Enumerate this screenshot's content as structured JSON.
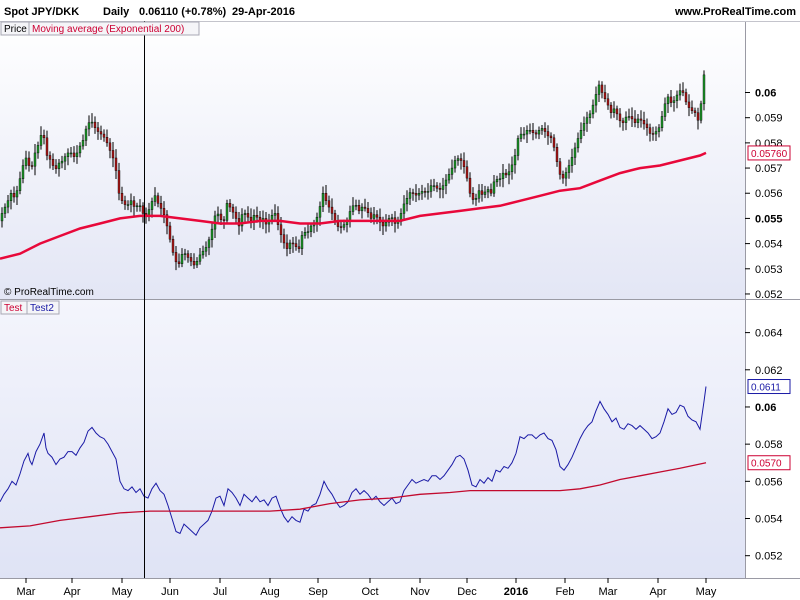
{
  "header": {
    "instrument": "Spot JPY/DKK",
    "period": "Daily",
    "last": "0.06110 (+0.78%)",
    "date": "29-Apr-2016",
    "site": "www.ProRealTime.com"
  },
  "watermark": "© ProRealTime.com",
  "chart_data": [
    {
      "type": "candlestick",
      "legend": [
        "Price",
        "Moving average (Exponential 200)"
      ],
      "yticks": [
        "0.052",
        "0.053",
        "0.054",
        "0.055",
        "0.056",
        "0.057",
        "0.058",
        "0.059",
        "0.06"
      ],
      "ylim": [
        0.0518,
        0.0628
      ],
      "value_labels": [
        {
          "text": "0.05760",
          "value": 0.0576,
          "color": "#cc0033"
        }
      ],
      "price_path": [
        [
          0,
          0.0549
        ],
        [
          4,
          0.0553
        ],
        [
          8,
          0.0556
        ],
        [
          12,
          0.056
        ],
        [
          16,
          0.0558
        ],
        [
          20,
          0.0564
        ],
        [
          24,
          0.0571
        ],
        [
          28,
          0.0575
        ],
        [
          30,
          0.0571
        ],
        [
          32,
          0.0569
        ],
        [
          36,
          0.0576
        ],
        [
          40,
          0.058
        ],
        [
          44,
          0.0586
        ],
        [
          46,
          0.0578
        ],
        [
          48,
          0.0575
        ],
        [
          52,
          0.0573
        ],
        [
          56,
          0.0569
        ],
        [
          60,
          0.0572
        ],
        [
          64,
          0.0573
        ],
        [
          68,
          0.0576
        ],
        [
          72,
          0.0576
        ],
        [
          76,
          0.0574
        ],
        [
          80,
          0.0578
        ],
        [
          84,
          0.0581
        ],
        [
          88,
          0.0587
        ],
        [
          92,
          0.0589
        ],
        [
          96,
          0.0586
        ],
        [
          100,
          0.0584
        ],
        [
          104,
          0.0583
        ],
        [
          108,
          0.058
        ],
        [
          112,
          0.0576
        ],
        [
          116,
          0.0572
        ],
        [
          120,
          0.056
        ],
        [
          124,
          0.0556
        ],
        [
          128,
          0.0555
        ],
        [
          132,
          0.0557
        ],
        [
          136,
          0.0554
        ],
        [
          140,
          0.0556
        ],
        [
          144,
          0.0552
        ],
        [
          148,
          0.0551
        ],
        [
          152,
          0.0556
        ],
        [
          156,
          0.0559
        ],
        [
          160,
          0.0555
        ],
        [
          164,
          0.0553
        ],
        [
          168,
          0.0547
        ],
        [
          172,
          0.054
        ],
        [
          176,
          0.0533
        ],
        [
          180,
          0.0532
        ],
        [
          184,
          0.0537
        ],
        [
          188,
          0.0535
        ],
        [
          192,
          0.0533
        ],
        [
          196,
          0.0531
        ],
        [
          200,
          0.0535
        ],
        [
          204,
          0.0537
        ],
        [
          208,
          0.0539
        ],
        [
          212,
          0.0544
        ],
        [
          216,
          0.0551
        ],
        [
          220,
          0.0552
        ],
        [
          224,
          0.0547
        ],
        [
          228,
          0.0556
        ],
        [
          232,
          0.0554
        ],
        [
          236,
          0.0551
        ],
        [
          240,
          0.0547
        ],
        [
          244,
          0.0553
        ],
        [
          248,
          0.0551
        ],
        [
          252,
          0.0549
        ],
        [
          256,
          0.0552
        ],
        [
          260,
          0.0549
        ],
        [
          264,
          0.055
        ],
        [
          268,
          0.0547
        ],
        [
          272,
          0.0551
        ],
        [
          276,
          0.0552
        ],
        [
          280,
          0.0546
        ],
        [
          284,
          0.0541
        ],
        [
          288,
          0.0538
        ],
        [
          292,
          0.0541
        ],
        [
          296,
          0.0539
        ],
        [
          300,
          0.0538
        ],
        [
          304,
          0.0545
        ],
        [
          308,
          0.0544
        ],
        [
          312,
          0.0547
        ],
        [
          316,
          0.0548
        ],
        [
          320,
          0.0553
        ],
        [
          324,
          0.056
        ],
        [
          328,
          0.0556
        ],
        [
          332,
          0.0553
        ],
        [
          336,
          0.0549
        ],
        [
          340,
          0.0546
        ],
        [
          344,
          0.0547
        ],
        [
          348,
          0.0549
        ],
        [
          352,
          0.0554
        ],
        [
          356,
          0.0556
        ],
        [
          360,
          0.0553
        ],
        [
          364,
          0.0555
        ],
        [
          368,
          0.0553
        ],
        [
          372,
          0.055
        ],
        [
          376,
          0.0552
        ],
        [
          380,
          0.0549
        ],
        [
          384,
          0.0547
        ],
        [
          388,
          0.0549
        ],
        [
          392,
          0.0551
        ],
        [
          396,
          0.0548
        ],
        [
          400,
          0.0549
        ],
        [
          404,
          0.0555
        ],
        [
          408,
          0.0558
        ],
        [
          412,
          0.0561
        ],
        [
          416,
          0.0559
        ],
        [
          420,
          0.056
        ],
        [
          424,
          0.0561
        ],
        [
          428,
          0.056
        ],
        [
          432,
          0.0563
        ],
        [
          436,
          0.0563
        ],
        [
          440,
          0.0561
        ],
        [
          444,
          0.0563
        ],
        [
          448,
          0.0566
        ],
        [
          452,
          0.0569
        ],
        [
          456,
          0.0573
        ],
        [
          460,
          0.0574
        ],
        [
          464,
          0.0572
        ],
        [
          468,
          0.0566
        ],
        [
          472,
          0.0558
        ],
        [
          476,
          0.0557
        ],
        [
          480,
          0.0561
        ],
        [
          484,
          0.0559
        ],
        [
          488,
          0.0562
        ],
        [
          492,
          0.056
        ],
        [
          496,
          0.0566
        ],
        [
          500,
          0.0565
        ],
        [
          504,
          0.0568
        ],
        [
          508,
          0.0567
        ],
        [
          512,
          0.057
        ],
        [
          516,
          0.0575
        ],
        [
          520,
          0.0584
        ],
        [
          524,
          0.0583
        ],
        [
          528,
          0.0585
        ],
        [
          532,
          0.0585
        ],
        [
          536,
          0.0583
        ],
        [
          540,
          0.0585
        ],
        [
          544,
          0.0586
        ],
        [
          548,
          0.0583
        ],
        [
          552,
          0.0582
        ],
        [
          556,
          0.0577
        ],
        [
          560,
          0.0568
        ],
        [
          564,
          0.0566
        ],
        [
          568,
          0.0569
        ],
        [
          572,
          0.0573
        ],
        [
          576,
          0.0578
        ],
        [
          580,
          0.0583
        ],
        [
          584,
          0.0587
        ],
        [
          588,
          0.059
        ],
        [
          592,
          0.0592
        ],
        [
          596,
          0.0598
        ],
        [
          600,
          0.0603
        ],
        [
          604,
          0.0599
        ],
        [
          608,
          0.0596
        ],
        [
          612,
          0.0592
        ],
        [
          616,
          0.0594
        ],
        [
          620,
          0.0589
        ],
        [
          624,
          0.0588
        ],
        [
          628,
          0.0591
        ],
        [
          632,
          0.059
        ],
        [
          636,
          0.0588
        ],
        [
          640,
          0.059
        ],
        [
          644,
          0.0588
        ],
        [
          648,
          0.0586
        ],
        [
          652,
          0.0583
        ],
        [
          656,
          0.0584
        ],
        [
          660,
          0.0586
        ],
        [
          664,
          0.0592
        ],
        [
          668,
          0.0599
        ],
        [
          672,
          0.0596
        ],
        [
          676,
          0.0597
        ],
        [
          680,
          0.0601
        ],
        [
          684,
          0.06
        ],
        [
          688,
          0.0595
        ],
        [
          692,
          0.0593
        ],
        [
          696,
          0.0592
        ],
        [
          700,
          0.0588
        ],
        [
          704,
          0.0603
        ],
        [
          706,
          0.0611
        ]
      ],
      "ema_path": [
        [
          0,
          0.0534
        ],
        [
          20,
          0.0536
        ],
        [
          40,
          0.054
        ],
        [
          60,
          0.0543
        ],
        [
          80,
          0.0546
        ],
        [
          100,
          0.0548
        ],
        [
          120,
          0.055
        ],
        [
          140,
          0.0551
        ],
        [
          160,
          0.0551
        ],
        [
          180,
          0.055
        ],
        [
          200,
          0.0549
        ],
        [
          220,
          0.0548
        ],
        [
          240,
          0.0548
        ],
        [
          260,
          0.0549
        ],
        [
          280,
          0.0549
        ],
        [
          300,
          0.0548
        ],
        [
          320,
          0.0548
        ],
        [
          340,
          0.0549
        ],
        [
          360,
          0.0549
        ],
        [
          380,
          0.0549
        ],
        [
          400,
          0.0549
        ],
        [
          420,
          0.0551
        ],
        [
          440,
          0.0552
        ],
        [
          460,
          0.0553
        ],
        [
          480,
          0.0554
        ],
        [
          500,
          0.0555
        ],
        [
          520,
          0.0557
        ],
        [
          540,
          0.0559
        ],
        [
          560,
          0.0561
        ],
        [
          580,
          0.0562
        ],
        [
          600,
          0.0565
        ],
        [
          620,
          0.0568
        ],
        [
          640,
          0.057
        ],
        [
          660,
          0.0571
        ],
        [
          680,
          0.0573
        ],
        [
          700,
          0.0575
        ],
        [
          706,
          0.0576
        ]
      ]
    },
    {
      "type": "line",
      "legend": [
        "Test",
        "Test2"
      ],
      "yticks": [
        "0.052",
        "0.054",
        "0.056",
        "0.058",
        "0.06",
        "0.062",
        "0.064"
      ],
      "ylim": [
        0.0508,
        0.0657
      ],
      "value_labels": [
        {
          "text": "0.0611",
          "value": 0.0611,
          "color": "#1a1aa6"
        },
        {
          "text": "0.0570",
          "value": 0.057,
          "color": "#cc0033"
        }
      ],
      "ema_path": [
        [
          0,
          0.0535
        ],
        [
          30,
          0.0536
        ],
        [
          60,
          0.0539
        ],
        [
          90,
          0.0541
        ],
        [
          120,
          0.0543
        ],
        [
          150,
          0.0544
        ],
        [
          180,
          0.0544
        ],
        [
          210,
          0.0544
        ],
        [
          240,
          0.0544
        ],
        [
          270,
          0.0544
        ],
        [
          300,
          0.0545
        ],
        [
          330,
          0.0548
        ],
        [
          360,
          0.055
        ],
        [
          390,
          0.0551
        ],
        [
          420,
          0.0553
        ],
        [
          450,
          0.0554
        ],
        [
          470,
          0.0555
        ],
        [
          500,
          0.0555
        ],
        [
          530,
          0.0555
        ],
        [
          560,
          0.0555
        ],
        [
          580,
          0.0556
        ],
        [
          600,
          0.0558
        ],
        [
          620,
          0.0561
        ],
        [
          640,
          0.0563
        ],
        [
          660,
          0.0565
        ],
        [
          680,
          0.0567
        ],
        [
          706,
          0.057
        ]
      ]
    }
  ],
  "x_axis": {
    "labels": [
      "Mar",
      "Apr",
      "May",
      "Jun",
      "Jul",
      "Aug",
      "Sep",
      "Oct",
      "Nov",
      "Dec",
      "2016",
      "Feb",
      "Mar",
      "Apr",
      "May"
    ],
    "positions": [
      26,
      72,
      122,
      170,
      220,
      270,
      318,
      370,
      420,
      467,
      516,
      565,
      608,
      658,
      706
    ],
    "bold_label": "2016"
  },
  "colors": {
    "up": "#1f9a2b",
    "down": "#b01818",
    "ema": "#e8083a",
    "line": "#1a1aa6",
    "ema2": "#c20a2e"
  }
}
